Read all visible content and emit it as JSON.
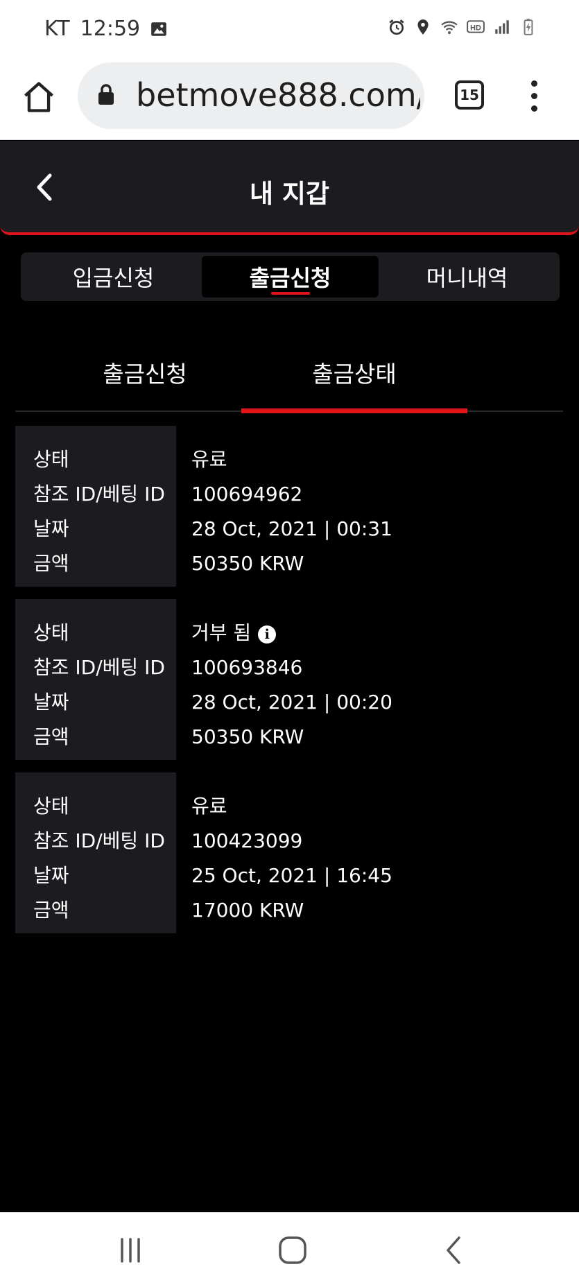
{
  "status_bar": {
    "carrier": "KT",
    "time": "12:59",
    "icons": [
      "image-icon",
      "alarm-icon",
      "location-icon",
      "wifi-icon",
      "hd-icon",
      "signal-icon",
      "battery-icon"
    ]
  },
  "browser": {
    "url": "betmove888.com/l",
    "tab_count": "15"
  },
  "header": {
    "title": "내 지갑"
  },
  "main_tabs": [
    {
      "label": "입금신청",
      "active": false
    },
    {
      "label": "출금신청",
      "active": true
    },
    {
      "label": "머니내역",
      "active": false
    }
  ],
  "sub_tabs": [
    {
      "label": "출금신청",
      "active": false
    },
    {
      "label": "출금상태",
      "active": true
    }
  ],
  "field_labels": {
    "status": "상태",
    "ref_id": "참조 ID/베팅 ID",
    "date": "날짜",
    "amount": "금액"
  },
  "records": [
    {
      "status": "유료",
      "ref_id": "100694962",
      "date": "28 Oct, 2021 | 00:31",
      "amount": "50350 KRW",
      "info": false
    },
    {
      "status": "거부 됨",
      "ref_id": "100693846",
      "date": "28 Oct, 2021 | 00:20",
      "amount": "50350 KRW",
      "info": true
    },
    {
      "status": "유료",
      "ref_id": "100423099",
      "date": "25 Oct, 2021 | 16:45",
      "amount": "17000 KRW",
      "info": false
    }
  ],
  "colors": {
    "accent": "#e1141a",
    "panel": "#1c1c20",
    "background": "#000000"
  }
}
